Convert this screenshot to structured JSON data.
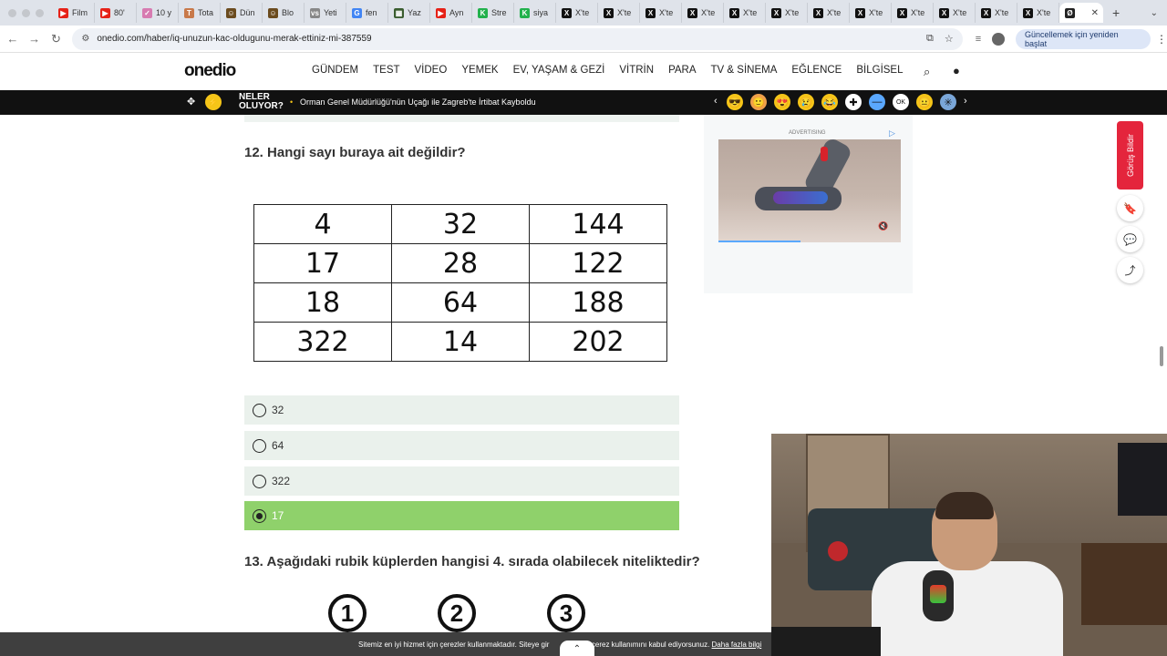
{
  "browser": {
    "tabs": [
      {
        "label": "Film",
        "color": "#e62117",
        "glyph": "▶"
      },
      {
        "label": "80'",
        "color": "#e62117",
        "glyph": "▶"
      },
      {
        "label": "10 y",
        "color": "#d77bb1",
        "glyph": "✓"
      },
      {
        "label": "Tota",
        "color": "#c8794a",
        "glyph": "T"
      },
      {
        "label": "Dün",
        "color": "#6b4b1e",
        "glyph": "☺"
      },
      {
        "label": "Blo",
        "color": "#6b4b1e",
        "glyph": "☺"
      },
      {
        "label": "Yeti",
        "color": "#888888",
        "glyph": "vs"
      },
      {
        "label": "fen",
        "color": "#4285f4",
        "glyph": "G"
      },
      {
        "label": "Yaz",
        "color": "#3a5d2f",
        "glyph": "▦"
      },
      {
        "label": "Ayn",
        "color": "#e62117",
        "glyph": "▶"
      },
      {
        "label": "Stre",
        "color": "#22b14c",
        "glyph": "K"
      },
      {
        "label": "siya",
        "color": "#22b14c",
        "glyph": "K"
      },
      {
        "label": "X'te",
        "color": "#111111",
        "glyph": "X"
      },
      {
        "label": "X'te",
        "color": "#111111",
        "glyph": "X"
      },
      {
        "label": "X'te",
        "color": "#111111",
        "glyph": "X"
      },
      {
        "label": "X'te",
        "color": "#111111",
        "glyph": "X"
      },
      {
        "label": "X'te",
        "color": "#111111",
        "glyph": "X"
      },
      {
        "label": "X'te",
        "color": "#111111",
        "glyph": "X"
      },
      {
        "label": "X'te",
        "color": "#111111",
        "glyph": "X"
      },
      {
        "label": "X'te",
        "color": "#111111",
        "glyph": "X"
      },
      {
        "label": "X'te",
        "color": "#111111",
        "glyph": "X"
      },
      {
        "label": "X'te",
        "color": "#111111",
        "glyph": "X"
      },
      {
        "label": "X'te",
        "color": "#111111",
        "glyph": "X"
      },
      {
        "label": "X'te",
        "color": "#111111",
        "glyph": "X"
      }
    ],
    "active_tab_glyph": "Ø",
    "active_tab_close": "✕",
    "new_tab": "+",
    "url": "onedio.com/haber/iq-unuzun-kac-oldugunu-merak-ettiniz-mi-387559",
    "update_button": "Güncellemek için yeniden başlat"
  },
  "site": {
    "logo": "onedio",
    "menu": [
      "GÜNDEM",
      "TEST",
      "VİDEO",
      "YEMEK",
      "EV, YAŞAM & GEZİ",
      "VİTRİN",
      "PARA",
      "TV & SİNEMA",
      "EĞLENCE",
      "BİLGİSEL"
    ]
  },
  "newsbar": {
    "badge": "⚡",
    "label_line1": "NELER",
    "label_line2": "OLUYOR?",
    "headline": "Orman Genel Müdürlüğü'nün Uçağı ile Zagreb'te İrtibat Kayboldu",
    "emojis": [
      {
        "glyph": "😎",
        "bg": "#f5c518"
      },
      {
        "glyph": "🙂",
        "bg": "#f0a04b"
      },
      {
        "glyph": "😍",
        "bg": "#f5c518"
      },
      {
        "glyph": "😢",
        "bg": "#f5c518"
      },
      {
        "glyph": "😂",
        "bg": "#f5c518"
      },
      {
        "glyph": "✚",
        "bg": "#ffffff"
      },
      {
        "glyph": "—",
        "bg": "#5aa8ff"
      },
      {
        "glyph": "OK",
        "bg": "#ffffff"
      },
      {
        "glyph": "😐",
        "bg": "#f5c518"
      },
      {
        "glyph": "✳",
        "bg": "#7aa6d8"
      }
    ]
  },
  "quiz": {
    "q12": {
      "title": "12. Hangi sayı buraya ait değildir?",
      "table": [
        [
          "4",
          "32",
          "144"
        ],
        [
          "17",
          "28",
          "122"
        ],
        [
          "18",
          "64",
          "188"
        ],
        [
          "322",
          "14",
          "202"
        ]
      ],
      "options": [
        {
          "label": "32",
          "state": "unselected"
        },
        {
          "label": "64",
          "state": "unselected"
        },
        {
          "label": "322",
          "state": "unselected"
        },
        {
          "label": "17",
          "state": "selected-correct"
        }
      ]
    },
    "q13": {
      "title": "13. Aşağıdaki rubik küplerden hangisi 4. sırada olabilecek niteliktedir?",
      "numbers": [
        "1",
        "2",
        "3"
      ]
    }
  },
  "sidebar": {
    "ad_label": "ADVERTISING",
    "feedback": "Görüş Bildir"
  },
  "cookie": {
    "text": "Sitemiz en iyi hizmet için çerezler kullanmaktadır. Siteye gir",
    "text2": "çerez kullanımını kabul ediyorsunuz.",
    "link": "Daha fazla bilgi"
  }
}
